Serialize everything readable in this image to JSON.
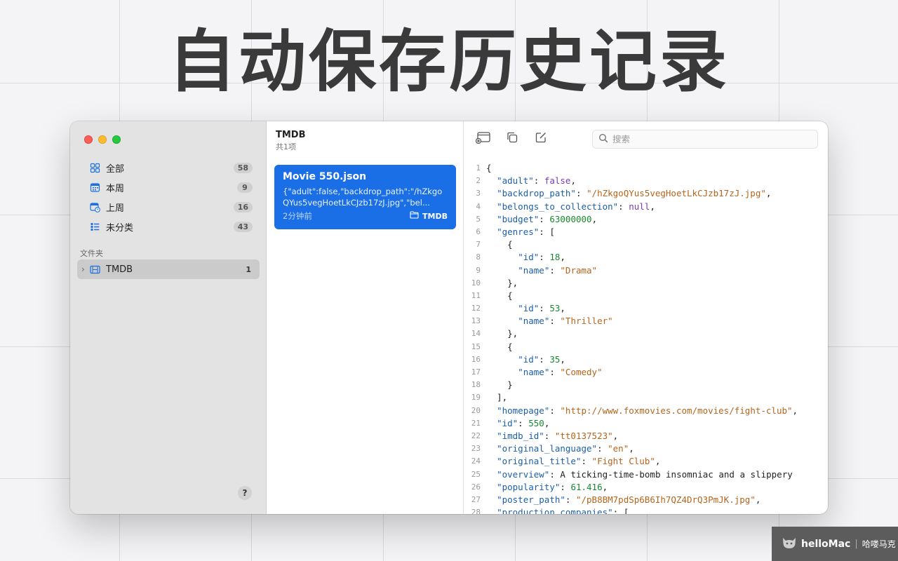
{
  "headline": "自动保存历史记录",
  "sidebar": {
    "items": [
      {
        "label": "全部",
        "count": "58",
        "icon": "grid-icon"
      },
      {
        "label": "本周",
        "count": "9",
        "icon": "calendar-week-icon"
      },
      {
        "label": "上周",
        "count": "16",
        "icon": "calendar-clock-icon"
      },
      {
        "label": "未分类",
        "count": "43",
        "icon": "list-icon"
      }
    ],
    "section_title": "文件夹",
    "folders": [
      {
        "label": "TMDB",
        "count": "1",
        "icon": "film-icon"
      }
    ],
    "help": "?"
  },
  "list": {
    "title": "TMDB",
    "subtitle": "共1项",
    "cards": [
      {
        "title": "Movie 550.json",
        "snippet": "{\"adult\":false,\"backdrop_path\":\"/hZkgoQYus5vegHoetLkCJzb17zJ.jpg\",\"bel...",
        "time": "2分钟前",
        "folder": "TMDB"
      }
    ]
  },
  "toolbar": {
    "search_placeholder": "搜索",
    "buttons": [
      "new-window-icon",
      "copy-icon",
      "edit-icon"
    ]
  },
  "code": {
    "lines": [
      "{",
      "  \"adult\": false,",
      "  \"backdrop_path\": \"/hZkgoQYus5vegHoetLkCJzb17zJ.jpg\",",
      "  \"belongs_to_collection\": null,",
      "  \"budget\": 63000000,",
      "  \"genres\": [",
      "    {",
      "      \"id\": 18,",
      "      \"name\": \"Drama\"",
      "    },",
      "    {",
      "      \"id\": 53,",
      "      \"name\": \"Thriller\"",
      "    },",
      "    {",
      "      \"id\": 35,",
      "      \"name\": \"Comedy\"",
      "    }",
      "  ],",
      "  \"homepage\": \"http://www.foxmovies.com/movies/fight-club\",",
      "  \"id\": 550,",
      "  \"imdb_id\": \"tt0137523\",",
      "  \"original_language\": \"en\",",
      "  \"original_title\": \"Fight Club\",",
      "  \"overview\": \"A ticking-time-bomb insomniac and a slippery",
      "  \"popularity\": 61.416,",
      "  \"poster_path\": \"/pB8BM7pdSp6B6Ih7QZ4DrQ3PmJK.jpg\",",
      "  \"production_companies\": ["
    ]
  },
  "watermark": {
    "brand": "helloMac",
    "cn": "哈喽马克"
  },
  "colors": {
    "accent": "#1a6ee6",
    "key": "#1c5fa8",
    "string": "#b5641c",
    "number": "#178a2e",
    "keyword": "#7a3bb8"
  }
}
